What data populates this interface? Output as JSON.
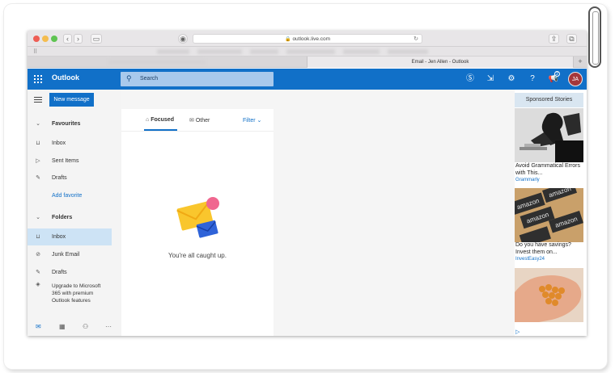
{
  "browser": {
    "url": "outlook.live.com",
    "tab_title": "Email - Jen Allen - Outlook",
    "new_tab": "+",
    "traffic_lights": [
      "#ee5e55",
      "#f5bd4f",
      "#5fc452"
    ]
  },
  "header": {
    "brand": "Outlook",
    "search_placeholder": "Search",
    "notification_count": "2",
    "avatar_initials": "JA",
    "accent": "#1170c8"
  },
  "sidebar": {
    "new_message": "New message",
    "sections": {
      "favourites": "Favourites",
      "folders": "Folders"
    },
    "favourites": [
      {
        "label": "Inbox",
        "icon": "inbox-icon"
      },
      {
        "label": "Sent Items",
        "icon": "send-icon"
      },
      {
        "label": "Drafts",
        "icon": "pencil-icon"
      }
    ],
    "add_favorite": "Add favorite",
    "folders": [
      {
        "label": "Inbox",
        "icon": "inbox-icon",
        "selected": true
      },
      {
        "label": "Junk Email",
        "icon": "block-icon"
      },
      {
        "label": "Drafts",
        "icon": "pencil-icon"
      }
    ],
    "upgrade": "Upgrade to Microsoft 365 with premium Outlook features"
  },
  "message_list": {
    "tabs": [
      "Focused",
      "Other"
    ],
    "filter": "Filter",
    "empty_state": "You're all caught up."
  },
  "ads": {
    "heading": "Sponsored Stories",
    "items": [
      {
        "title": "Avoid Grammatical Errors with This...",
        "source": "Grammarly"
      },
      {
        "title": "Do you have savings? Invest them on...",
        "source": "InvestEasy24"
      }
    ]
  }
}
